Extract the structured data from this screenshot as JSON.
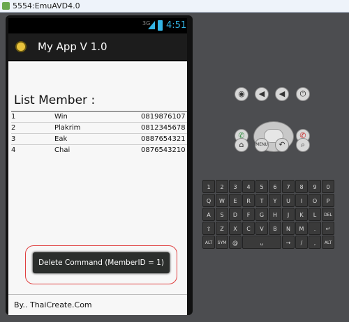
{
  "window": {
    "title": "5554:EmuAVD4.0"
  },
  "statusbar": {
    "network": "3G",
    "time": "4:51"
  },
  "app": {
    "title": "My App V 1.0"
  },
  "list": {
    "heading": "List Member :",
    "rows": [
      {
        "id": "1",
        "name": "Win",
        "phone": "0819876107"
      },
      {
        "id": "2",
        "name": "Plakrim",
        "phone": "0812345678"
      },
      {
        "id": "3",
        "name": "Eak",
        "phone": "0887654321"
      },
      {
        "id": "4",
        "name": "Chai",
        "phone": "0876543210"
      }
    ]
  },
  "toast": {
    "text": "Delete Command (MemberID = 1)"
  },
  "footer": {
    "text": "By.. ThaiCreate.Com"
  },
  "emulator": {
    "top_buttons": [
      "camera-icon",
      "volume-down-icon",
      "volume-up-icon",
      "power-icon"
    ],
    "call_icon": "call-icon",
    "end_call_icon": "end-call-icon",
    "bottom_buttons": [
      {
        "icon": "home-icon"
      },
      {
        "label": "MENU"
      },
      {
        "icon": "back-icon"
      },
      {
        "icon": "search-icon"
      }
    ],
    "keyboard": {
      "row1": [
        "1",
        "2",
        "3",
        "4",
        "5",
        "6",
        "7",
        "8",
        "9",
        "0"
      ],
      "row2": [
        "Q",
        "W",
        "E",
        "R",
        "T",
        "Y",
        "U",
        "I",
        "O",
        "P"
      ],
      "row3": [
        "A",
        "S",
        "D",
        "F",
        "G",
        "H",
        "J",
        "K",
        "L",
        "DEL"
      ],
      "row4": [
        "⇧",
        "Z",
        "X",
        "C",
        "V",
        "B",
        "N",
        "M",
        ".",
        "↵"
      ],
      "row5": [
        "ALT",
        "SYM",
        "@",
        "␣",
        "→",
        "/",
        ",",
        "ALT"
      ]
    }
  },
  "colors": {
    "accent": "#33b5e5",
    "toast_outline": "#e04040",
    "emulator_bg": "#4c4d50"
  }
}
